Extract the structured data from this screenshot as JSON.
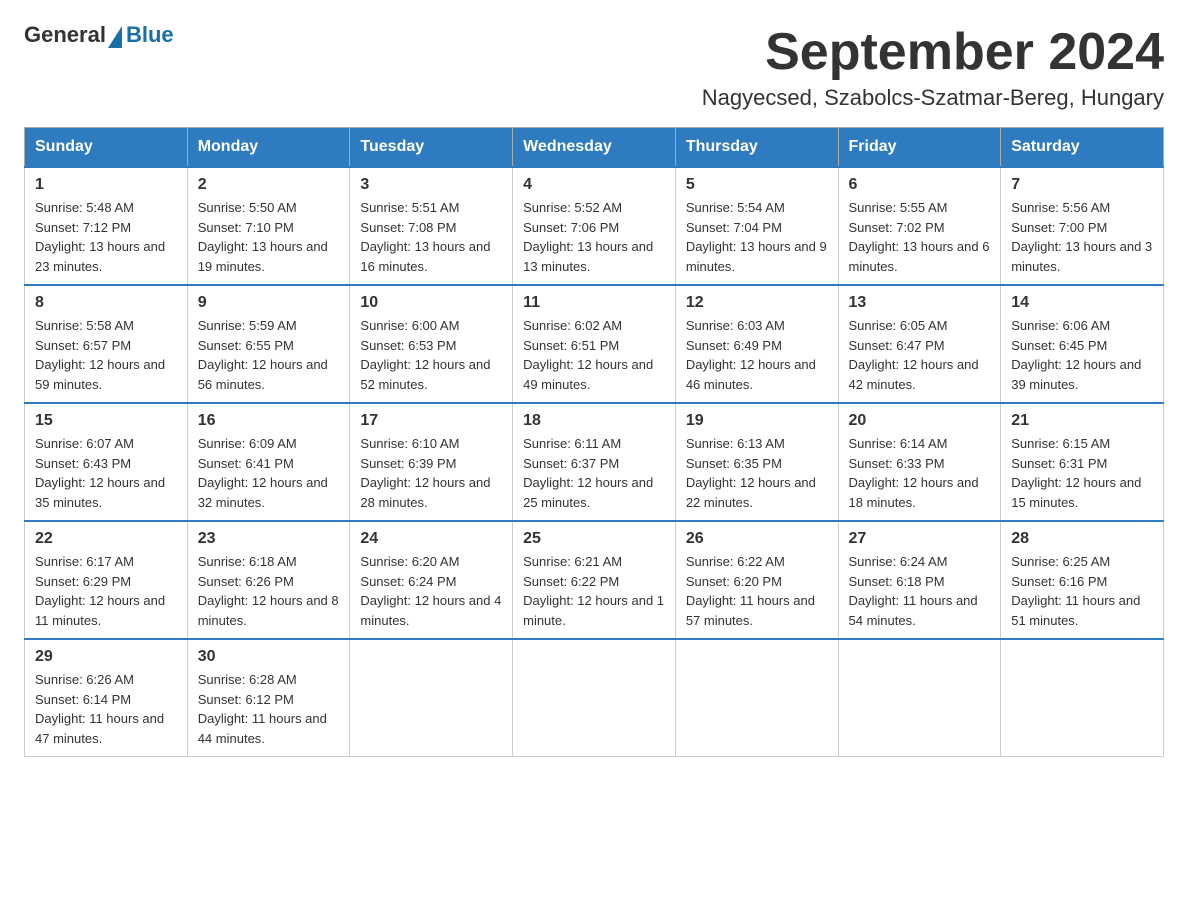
{
  "header": {
    "logo_general": "General",
    "logo_blue": "Blue",
    "month_title": "September 2024",
    "location": "Nagyecsed, Szabolcs-Szatmar-Bereg, Hungary"
  },
  "weekdays": [
    "Sunday",
    "Monday",
    "Tuesday",
    "Wednesday",
    "Thursday",
    "Friday",
    "Saturday"
  ],
  "weeks": [
    [
      {
        "day": "1",
        "sunrise": "5:48 AM",
        "sunset": "7:12 PM",
        "daylight": "13 hours and 23 minutes."
      },
      {
        "day": "2",
        "sunrise": "5:50 AM",
        "sunset": "7:10 PM",
        "daylight": "13 hours and 19 minutes."
      },
      {
        "day": "3",
        "sunrise": "5:51 AM",
        "sunset": "7:08 PM",
        "daylight": "13 hours and 16 minutes."
      },
      {
        "day": "4",
        "sunrise": "5:52 AM",
        "sunset": "7:06 PM",
        "daylight": "13 hours and 13 minutes."
      },
      {
        "day": "5",
        "sunrise": "5:54 AM",
        "sunset": "7:04 PM",
        "daylight": "13 hours and 9 minutes."
      },
      {
        "day": "6",
        "sunrise": "5:55 AM",
        "sunset": "7:02 PM",
        "daylight": "13 hours and 6 minutes."
      },
      {
        "day": "7",
        "sunrise": "5:56 AM",
        "sunset": "7:00 PM",
        "daylight": "13 hours and 3 minutes."
      }
    ],
    [
      {
        "day": "8",
        "sunrise": "5:58 AM",
        "sunset": "6:57 PM",
        "daylight": "12 hours and 59 minutes."
      },
      {
        "day": "9",
        "sunrise": "5:59 AM",
        "sunset": "6:55 PM",
        "daylight": "12 hours and 56 minutes."
      },
      {
        "day": "10",
        "sunrise": "6:00 AM",
        "sunset": "6:53 PM",
        "daylight": "12 hours and 52 minutes."
      },
      {
        "day": "11",
        "sunrise": "6:02 AM",
        "sunset": "6:51 PM",
        "daylight": "12 hours and 49 minutes."
      },
      {
        "day": "12",
        "sunrise": "6:03 AM",
        "sunset": "6:49 PM",
        "daylight": "12 hours and 46 minutes."
      },
      {
        "day": "13",
        "sunrise": "6:05 AM",
        "sunset": "6:47 PM",
        "daylight": "12 hours and 42 minutes."
      },
      {
        "day": "14",
        "sunrise": "6:06 AM",
        "sunset": "6:45 PM",
        "daylight": "12 hours and 39 minutes."
      }
    ],
    [
      {
        "day": "15",
        "sunrise": "6:07 AM",
        "sunset": "6:43 PM",
        "daylight": "12 hours and 35 minutes."
      },
      {
        "day": "16",
        "sunrise": "6:09 AM",
        "sunset": "6:41 PM",
        "daylight": "12 hours and 32 minutes."
      },
      {
        "day": "17",
        "sunrise": "6:10 AM",
        "sunset": "6:39 PM",
        "daylight": "12 hours and 28 minutes."
      },
      {
        "day": "18",
        "sunrise": "6:11 AM",
        "sunset": "6:37 PM",
        "daylight": "12 hours and 25 minutes."
      },
      {
        "day": "19",
        "sunrise": "6:13 AM",
        "sunset": "6:35 PM",
        "daylight": "12 hours and 22 minutes."
      },
      {
        "day": "20",
        "sunrise": "6:14 AM",
        "sunset": "6:33 PM",
        "daylight": "12 hours and 18 minutes."
      },
      {
        "day": "21",
        "sunrise": "6:15 AM",
        "sunset": "6:31 PM",
        "daylight": "12 hours and 15 minutes."
      }
    ],
    [
      {
        "day": "22",
        "sunrise": "6:17 AM",
        "sunset": "6:29 PM",
        "daylight": "12 hours and 11 minutes."
      },
      {
        "day": "23",
        "sunrise": "6:18 AM",
        "sunset": "6:26 PM",
        "daylight": "12 hours and 8 minutes."
      },
      {
        "day": "24",
        "sunrise": "6:20 AM",
        "sunset": "6:24 PM",
        "daylight": "12 hours and 4 minutes."
      },
      {
        "day": "25",
        "sunrise": "6:21 AM",
        "sunset": "6:22 PM",
        "daylight": "12 hours and 1 minute."
      },
      {
        "day": "26",
        "sunrise": "6:22 AM",
        "sunset": "6:20 PM",
        "daylight": "11 hours and 57 minutes."
      },
      {
        "day": "27",
        "sunrise": "6:24 AM",
        "sunset": "6:18 PM",
        "daylight": "11 hours and 54 minutes."
      },
      {
        "day": "28",
        "sunrise": "6:25 AM",
        "sunset": "6:16 PM",
        "daylight": "11 hours and 51 minutes."
      }
    ],
    [
      {
        "day": "29",
        "sunrise": "6:26 AM",
        "sunset": "6:14 PM",
        "daylight": "11 hours and 47 minutes."
      },
      {
        "day": "30",
        "sunrise": "6:28 AM",
        "sunset": "6:12 PM",
        "daylight": "11 hours and 44 minutes."
      },
      null,
      null,
      null,
      null,
      null
    ]
  ]
}
